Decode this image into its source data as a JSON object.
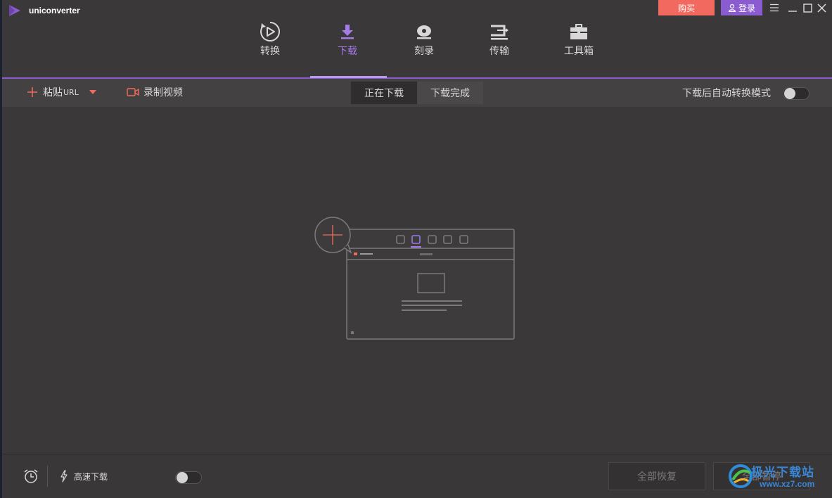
{
  "app": {
    "name": "uniconverter",
    "brand_color": "#8a5cd0"
  },
  "header": {
    "buy_label": "购买",
    "login_label": "登录",
    "nav": [
      {
        "label": "转换",
        "icon": "convert-icon",
        "active": false
      },
      {
        "label": "下载",
        "icon": "download-icon",
        "active": true
      },
      {
        "label": "刻录",
        "icon": "burn-icon",
        "active": false
      },
      {
        "label": "传输",
        "icon": "transfer-icon",
        "active": false
      },
      {
        "label": "工具箱",
        "icon": "toolbox-icon",
        "active": false
      }
    ]
  },
  "toolbar": {
    "paste_label": "粘贴",
    "paste_suffix": "URL",
    "record_label": "录制视频",
    "tabs": [
      "正在下载",
      "下载完成"
    ],
    "active_tab": 0,
    "auto_convert_label": "下载后自动转换模式",
    "auto_convert_on": false
  },
  "footer": {
    "fast_download_label": "高速下载",
    "fast_download_on": false,
    "resume_all_label": "全部恢复",
    "pause_all_label": "全部暂停"
  },
  "watermark": {
    "site": "极光下载站",
    "url": "www.xz7.com"
  },
  "colors": {
    "accent": "#a47be8",
    "buy": "#f26a5f",
    "plus": "#f26a5f",
    "bg": "#3b3839"
  }
}
